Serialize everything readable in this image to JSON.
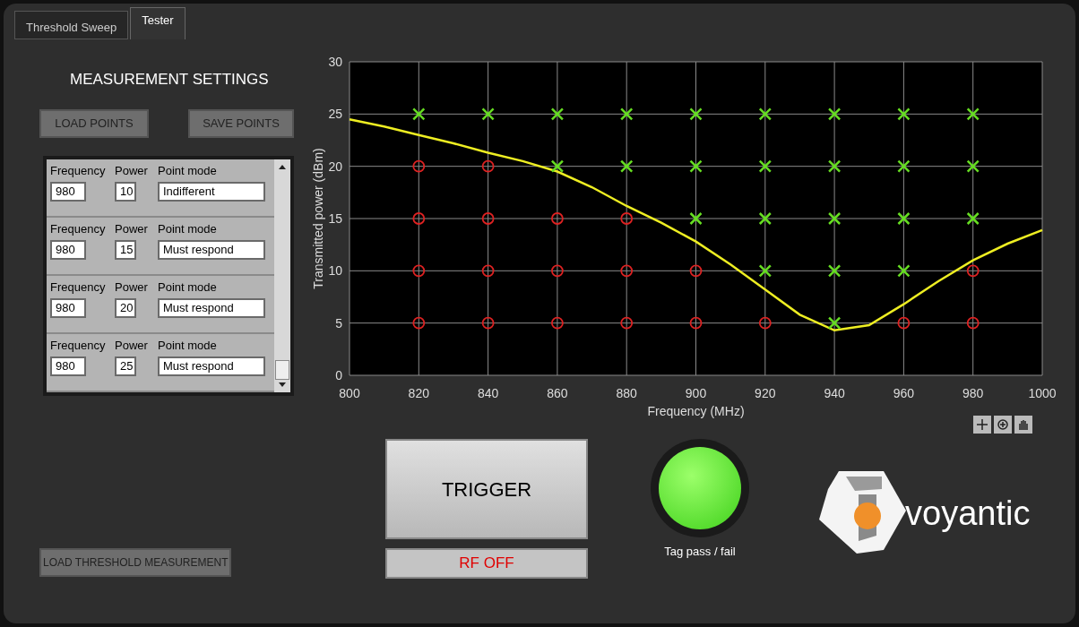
{
  "tabs": [
    {
      "label": "Threshold Sweep",
      "selected": false
    },
    {
      "label": "Tester",
      "selected": true
    }
  ],
  "settings": {
    "title": "MEASUREMENT SETTINGS",
    "load_button": "LOAD POINTS",
    "save_button": "SAVE POINTS",
    "points": [
      {
        "frequency_label": "Frequency",
        "power_label": "Power",
        "mode_label": "Point mode",
        "frequency": "980",
        "power": "10",
        "mode": "Indifferent"
      },
      {
        "frequency_label": "Frequency",
        "power_label": "Power",
        "mode_label": "Point mode",
        "frequency": "980",
        "power": "15",
        "mode": "Must respond"
      },
      {
        "frequency_label": "Frequency",
        "power_label": "Power",
        "mode_label": "Point mode",
        "frequency": "980",
        "power": "20",
        "mode": "Must respond"
      },
      {
        "frequency_label": "Frequency",
        "power_label": "Power",
        "mode_label": "Point mode",
        "frequency": "980",
        "power": "25",
        "mode": "Must respond"
      }
    ],
    "threshold_button": "LOAD THRESHOLD MEASUREMENT"
  },
  "chart": {
    "chart_data": {
      "type": "scatter",
      "grid": true,
      "xlabel": "Frequency (MHz)",
      "ylabel": "Transmitted power (dBm)",
      "xlim": [
        800,
        1000
      ],
      "ylim": [
        0,
        30
      ],
      "xticks": [
        800,
        820,
        840,
        860,
        880,
        900,
        920,
        940,
        960,
        980,
        1000
      ],
      "yticks": [
        0,
        5,
        10,
        15,
        20,
        25,
        30
      ],
      "x": [
        800,
        810,
        820,
        830,
        840,
        850,
        860,
        870,
        880,
        890,
        900,
        910,
        920,
        930,
        940,
        950,
        960,
        970,
        980,
        990,
        1000
      ],
      "series": [
        {
          "type": "line",
          "color": "#eeee22",
          "values": [
            24.5,
            23.8,
            23,
            22.2,
            21.3,
            20.5,
            19.5,
            18,
            16.2,
            14.6,
            12.8,
            10.6,
            8.2,
            5.8,
            4.3,
            4.8,
            6.8,
            9,
            11,
            12.6,
            13.9
          ]
        },
        {
          "type": "scatter",
          "marker": "x",
          "color": "#66dd22",
          "values": [
            null,
            null,
            25,
            null,
            25,
            null,
            25,
            null,
            25,
            null,
            25,
            null,
            25,
            null,
            25,
            null,
            25,
            null,
            25,
            null,
            null
          ]
        },
        {
          "type": "scatter",
          "marker": "x",
          "color": "#66dd22",
          "values": [
            null,
            null,
            null,
            null,
            null,
            null,
            20,
            null,
            20,
            null,
            20,
            null,
            20,
            null,
            20,
            null,
            20,
            null,
            20,
            null,
            null
          ]
        },
        {
          "type": "scatter",
          "marker": "x",
          "color": "#66dd22",
          "values": [
            null,
            null,
            null,
            null,
            null,
            null,
            null,
            null,
            null,
            null,
            15,
            null,
            15,
            null,
            15,
            null,
            15,
            null,
            15,
            null,
            null
          ]
        },
        {
          "type": "scatter",
          "marker": "x",
          "color": "#66dd22",
          "values": [
            null,
            null,
            null,
            null,
            null,
            null,
            null,
            null,
            null,
            null,
            null,
            null,
            10,
            null,
            10,
            null,
            10,
            null,
            null,
            null,
            null
          ]
        },
        {
          "type": "scatter",
          "marker": "x",
          "color": "#66dd22",
          "values": [
            null,
            null,
            null,
            null,
            null,
            null,
            null,
            null,
            null,
            null,
            null,
            null,
            null,
            null,
            5,
            null,
            null,
            null,
            null,
            null,
            null
          ]
        },
        {
          "type": "scatter",
          "marker": "o",
          "color": "#dd2222",
          "values": [
            null,
            null,
            20,
            null,
            20,
            null,
            null,
            null,
            null,
            null,
            null,
            null,
            null,
            null,
            null,
            null,
            null,
            null,
            null,
            null,
            null
          ]
        },
        {
          "type": "scatter",
          "marker": "o",
          "color": "#dd2222",
          "values": [
            null,
            null,
            15,
            null,
            15,
            null,
            15,
            null,
            15,
            null,
            null,
            null,
            null,
            null,
            null,
            null,
            null,
            null,
            null,
            null,
            null
          ]
        },
        {
          "type": "scatter",
          "marker": "o",
          "color": "#dd2222",
          "values": [
            null,
            null,
            10,
            null,
            10,
            null,
            10,
            null,
            10,
            null,
            10,
            null,
            null,
            null,
            null,
            null,
            null,
            null,
            10,
            null,
            null
          ]
        },
        {
          "type": "scatter",
          "marker": "o",
          "color": "#dd2222",
          "values": [
            null,
            null,
            5,
            null,
            5,
            null,
            5,
            null,
            5,
            null,
            5,
            null,
            5,
            null,
            null,
            null,
            5,
            null,
            5,
            null,
            null
          ]
        }
      ]
    }
  },
  "trigger": {
    "label": "TRIGGER",
    "status": "RF OFF"
  },
  "indicator": {
    "on": true,
    "label": "Tag pass / fail"
  },
  "logo": {
    "text": "voyantic"
  }
}
